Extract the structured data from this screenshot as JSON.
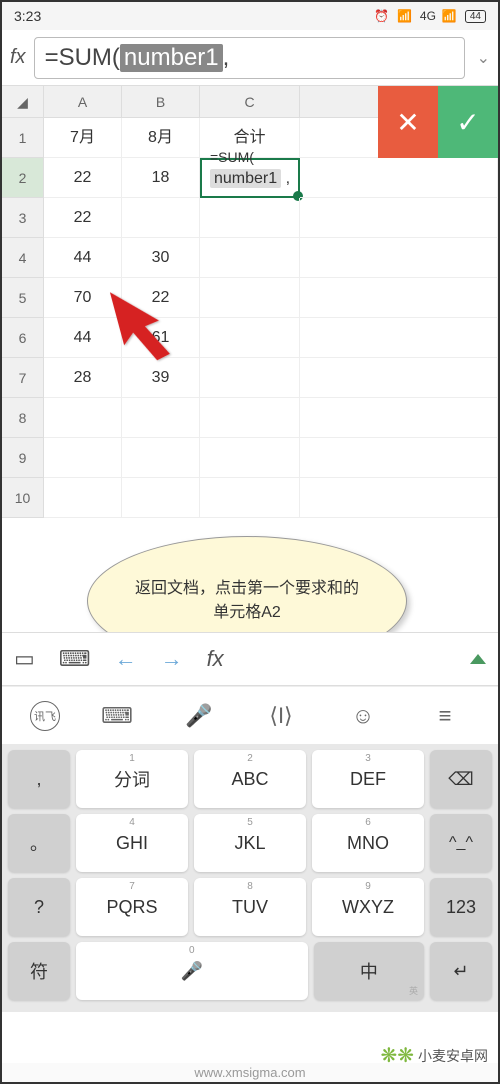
{
  "status": {
    "time": "3:23",
    "network": "4G",
    "battery": "44"
  },
  "formula": {
    "prefix": "=SUM(",
    "arg": "number1",
    "suffix": ","
  },
  "columns": [
    "A",
    "B",
    "C"
  ],
  "rows": [
    "1",
    "2",
    "3",
    "4",
    "5",
    "6",
    "7",
    "8",
    "9",
    "10"
  ],
  "data": {
    "headers": [
      "7月",
      "8月",
      "合计"
    ],
    "r2": {
      "a": "22",
      "b": "18",
      "c_hl": "number1",
      "c_suf": " ,"
    },
    "r3": {
      "a": "22",
      "b": ""
    },
    "r4": {
      "a": "44",
      "b": "30"
    },
    "r5": {
      "a": "70",
      "b": "22"
    },
    "r6": {
      "a": "44",
      "b": "61"
    },
    "r7": {
      "a": "28",
      "b": "39"
    },
    "overlay": "=SUM("
  },
  "annotation": "返回文档，点击第一个要求和的单元格A2",
  "toolbar_fx": "fx",
  "ime": {
    "iflytek": "讯飞"
  },
  "keys": {
    "r1": [
      ",",
      "分词",
      "ABC",
      "DEF",
      "⌫"
    ],
    "r1_nums": [
      "",
      "1",
      "2",
      "3",
      ""
    ],
    "r2": [
      "。",
      "GHI",
      "JKL",
      "MNO",
      "^_^"
    ],
    "r2_nums": [
      "",
      "4",
      "5",
      "6",
      ""
    ],
    "r3": [
      "?",
      "PQRS",
      "TUV",
      "WXYZ",
      "123"
    ],
    "r3_nums": [
      "",
      "7",
      "8",
      "9",
      ""
    ],
    "r4": [
      "符",
      "中",
      "英"
    ],
    "r4_num": "0",
    "mic": "🎤"
  },
  "watermark": {
    "text": "小麦安卓网",
    "url": "www.xmsigma.com"
  }
}
